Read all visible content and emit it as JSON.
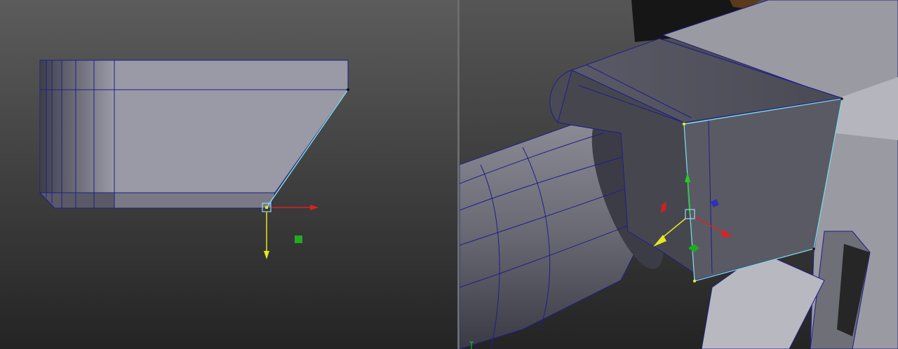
{
  "viewports": [
    {
      "name": "orthographic-view",
      "active": false
    },
    {
      "name": "perspective-view",
      "active": true
    }
  ],
  "colors": {
    "background_top": "#5a5a5a",
    "background_bottom": "#262626",
    "mesh_face": "#9b9ba6",
    "mesh_dark": "#55555f",
    "wireframe": "#1e1e8c",
    "selection": "#7fd9e6",
    "gizmo_x": "#e02020",
    "gizmo_y": "#e6e622",
    "gizmo_z": "#22cc22",
    "gizmo_center": "#8fdcf0"
  },
  "icons": {
    "move_gizmo_left": "move-tool-gizmo-icon",
    "move_gizmo_right": "move-tool-gizmo-icon"
  }
}
